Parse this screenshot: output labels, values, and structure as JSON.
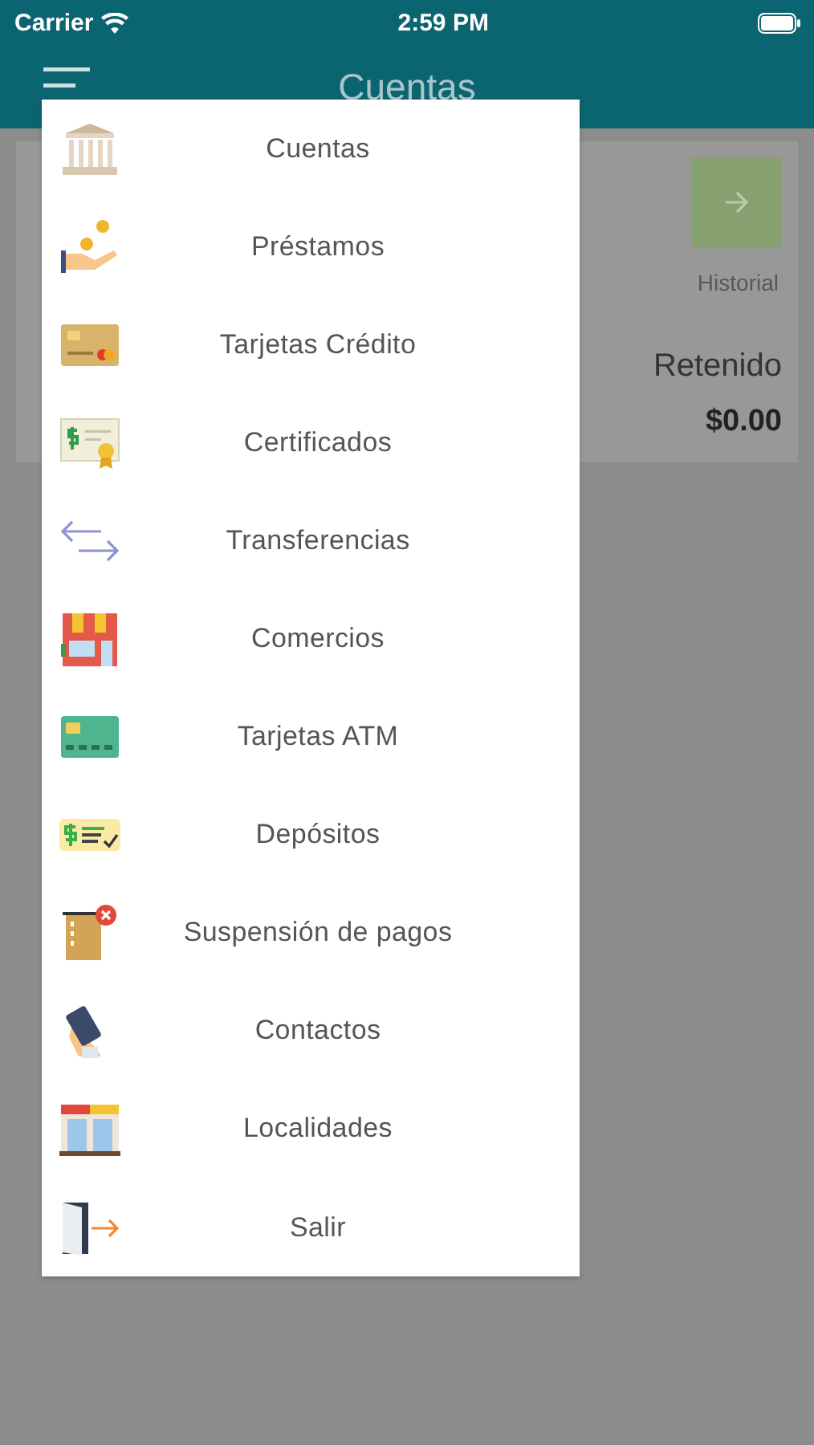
{
  "status_bar": {
    "carrier": "Carrier",
    "time": "2:59 PM"
  },
  "nav_bar": {
    "title": "Cuentas"
  },
  "account_card": {
    "history_label": "Historial",
    "held_label": "Retenido",
    "held_amount": "$0.00"
  },
  "menu": {
    "items": [
      {
        "label": "Cuentas"
      },
      {
        "label": "Préstamos"
      },
      {
        "label": "Tarjetas Crédito"
      },
      {
        "label": "Certificados"
      },
      {
        "label": "Transferencias"
      },
      {
        "label": "Comercios"
      },
      {
        "label": "Tarjetas ATM"
      },
      {
        "label": "Depósitos"
      },
      {
        "label": "Suspensión de pagos"
      },
      {
        "label": "Contactos"
      },
      {
        "label": "Localidades"
      },
      {
        "label": "Salir"
      }
    ]
  }
}
